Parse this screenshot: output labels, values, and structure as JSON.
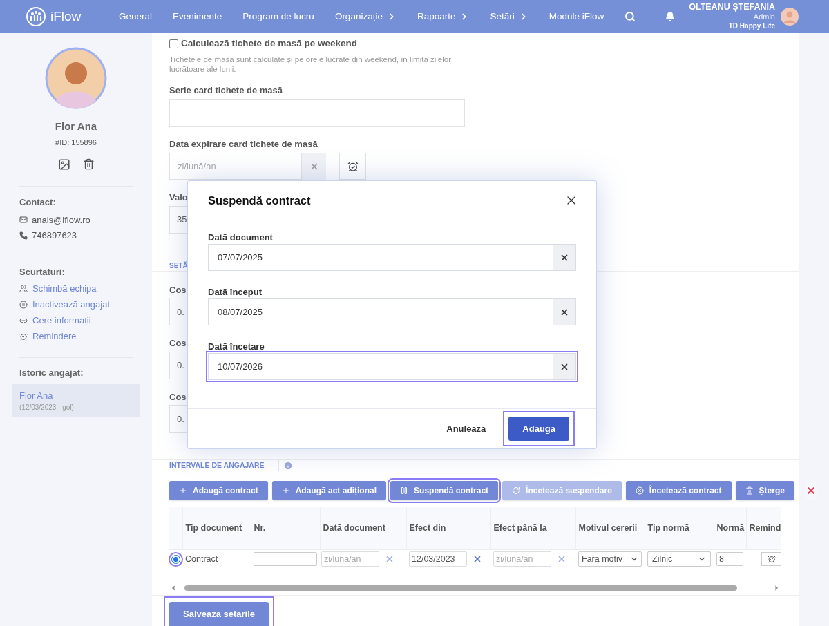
{
  "nav": {
    "brand": "iFlow",
    "items": [
      {
        "label": "General",
        "submenu": false
      },
      {
        "label": "Evenimente",
        "submenu": false
      },
      {
        "label": "Program de lucru",
        "submenu": false
      },
      {
        "label": "Organizație",
        "submenu": true
      },
      {
        "label": "Rapoarte",
        "submenu": true
      },
      {
        "label": "Setări",
        "submenu": true
      },
      {
        "label": "Module iFlow",
        "submenu": false
      }
    ],
    "user": {
      "name": "OLTEANU ȘTEFANIA",
      "role": "Admin",
      "company": "TD Happy Life"
    }
  },
  "profile": {
    "name": "Flor Ana",
    "id": "#ID: 155896",
    "contact_title": "Contact:",
    "email": "anais@iflow.ro",
    "phone": "746897623",
    "shortcuts_title": "Scurtături:",
    "shortcuts": [
      {
        "kind": "team",
        "label": "Schimbă echipa"
      },
      {
        "kind": "pause",
        "label": "Inactivează angajat"
      },
      {
        "kind": "link",
        "label": "Cere informații"
      },
      {
        "kind": "alarm",
        "label": "Remindere"
      }
    ],
    "history_title": "Istoric angajat:",
    "history": [
      {
        "name": "Flor Ana",
        "period": "(12/03/2023 - gol)",
        "selected": true
      }
    ]
  },
  "form": {
    "weekend": {
      "label": "Calculează tichete de masă pe weekend",
      "checked": false,
      "help": "Tichetele de masă sunt calculate și pe orele lucrate din weekend, în limita zilelor lucrătoare ale lunii."
    },
    "card_series": {
      "label": "Serie card tichete de masă"
    },
    "card_expiry": {
      "label": "Data expirare card tichete de masă",
      "placeholder": "zi/lună/an"
    },
    "value_field": {
      "label": "Valo",
      "value": "35"
    },
    "section": "SETĂ",
    "costs": [
      {
        "label": "Cos",
        "value": "0."
      },
      {
        "label": "Cos",
        "value": "0."
      },
      {
        "label": "Cos",
        "value": "0."
      }
    ]
  },
  "tab": {
    "label": "INTERVALE DE ANGAJARE"
  },
  "toolbar": [
    {
      "kind": "add",
      "label": "Adaugă contract",
      "disabled": false,
      "highlighted": false
    },
    {
      "kind": "add",
      "label": "Adaugă act adițional",
      "disabled": false,
      "highlighted": false
    },
    {
      "kind": "pause",
      "label": "Suspendă contract",
      "disabled": false,
      "highlighted": true
    },
    {
      "kind": "refresh",
      "label": "Încetează suspendare",
      "disabled": true,
      "highlighted": false
    },
    {
      "kind": "stop",
      "label": "Încetează contract",
      "disabled": false,
      "highlighted": false
    },
    {
      "kind": "delete",
      "label": "Șterge",
      "disabled": false,
      "highlighted": false
    },
    {
      "kind": "clear",
      "disabled": false,
      "highlighted": false
    }
  ],
  "table": {
    "columns": [
      "Tip document",
      "Nr.",
      "Dată document",
      "Efect din",
      "Efect până la",
      "Motivul cererii",
      "Tip normă",
      "Normă",
      "Remind"
    ],
    "rows": [
      {
        "selected": true,
        "highlighted": true,
        "type": "Contract",
        "doc_date_placeholder": "zi/lună/an",
        "from": "12/03/2023",
        "to_placeholder": "zi/lună/an",
        "reason": "Fără motiv",
        "norm_type": "Zilnic",
        "norm": "8"
      }
    ]
  },
  "save": {
    "label": "Salvează setările",
    "highlighted": true
  },
  "modal": {
    "title": "Suspendă contract",
    "fields": [
      {
        "label": "Dată document",
        "value": "07/07/2025",
        "highlighted": false
      },
      {
        "label": "Dată început",
        "value": "08/07/2025",
        "highlighted": false
      },
      {
        "label": "Dată încetare",
        "value": "10/07/2026",
        "highlighted": true
      }
    ],
    "cancel": "Anulează",
    "confirm": {
      "label": "Adaugă",
      "highlighted": true
    }
  }
}
